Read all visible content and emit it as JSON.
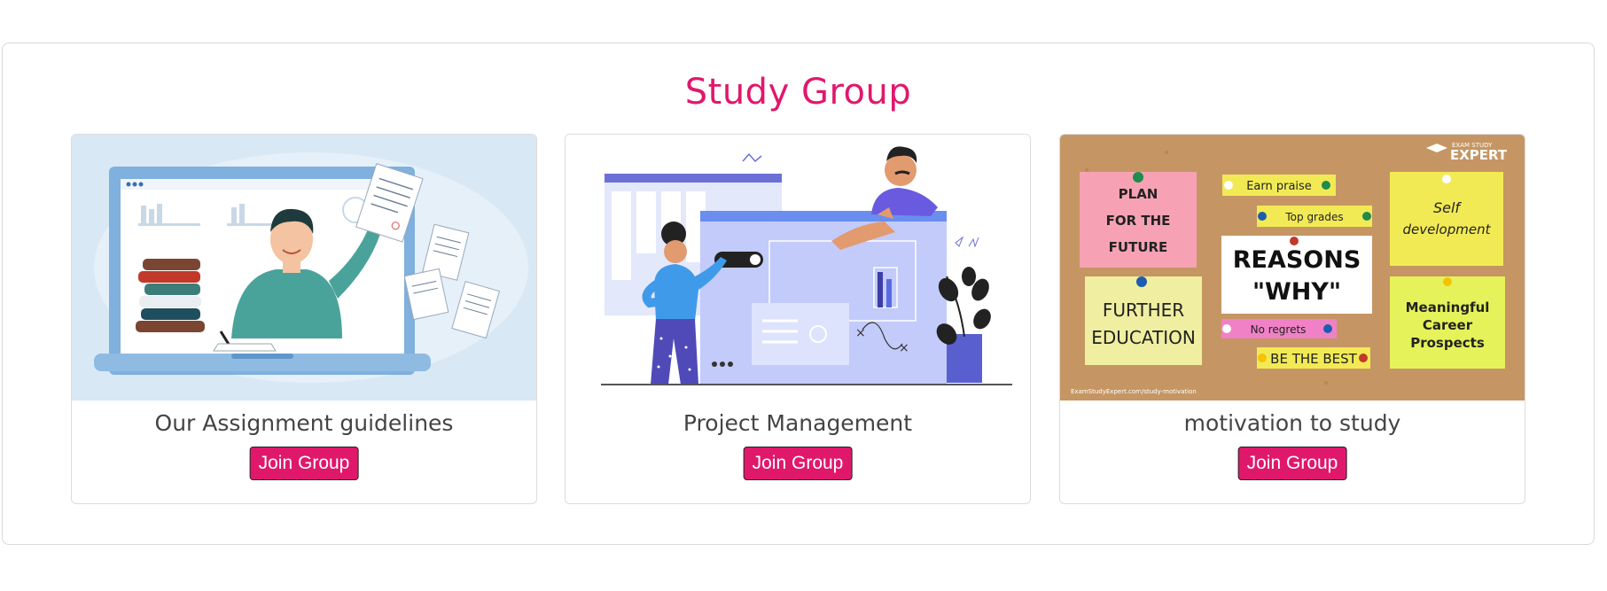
{
  "section": {
    "title": "Study Group"
  },
  "groups": [
    {
      "name": "Our Assignment guidelines",
      "button_label": "Join Group",
      "image": "online-teacher-laptop-illustration"
    },
    {
      "name": "Project Management",
      "button_label": "Join Group",
      "image": "project-dashboard-team-illustration"
    },
    {
      "name": "motivation to study",
      "button_label": "Join Group",
      "image": "corkboard-sticky-notes-photo"
    }
  ],
  "board": {
    "brand_top": "EXAM STUDY",
    "brand": "EXPERT",
    "notes": [
      "PLAN",
      "FOR THE",
      "FUTURE",
      "Earn praise",
      "Top grades",
      "REASONS",
      "\"WHY\"",
      "Self",
      "development",
      "FURTHER",
      "EDUCATION",
      "No regrets",
      "BE THE BEST",
      "Meaningful",
      "Career",
      "Prospects"
    ],
    "url": "ExamStudyExpert.com/study-motivation"
  },
  "colors": {
    "accent": "#e0186c",
    "button_bg": "#e0186c",
    "cork": "#c59663"
  }
}
